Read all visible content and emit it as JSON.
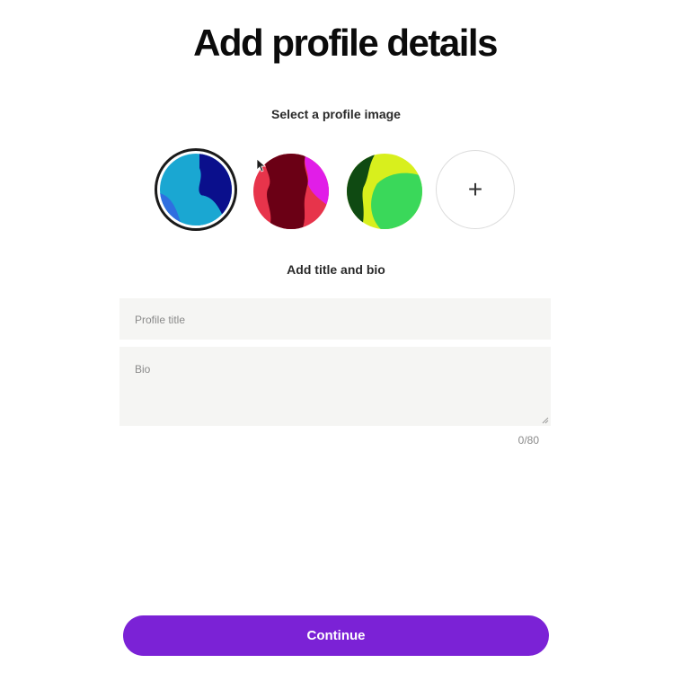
{
  "header": {
    "title": "Add profile details"
  },
  "profile_image": {
    "label": "Select a profile image",
    "options": [
      {
        "icon": "abstract-blue-avatar-icon",
        "selected": true,
        "colors": [
          "#1a9fce",
          "#0a0f8c",
          "#2e7be0"
        ]
      },
      {
        "icon": "abstract-red-avatar-icon",
        "selected": false,
        "colors": [
          "#e8324a",
          "#6a0014",
          "#e11de8"
        ]
      },
      {
        "icon": "abstract-green-avatar-icon",
        "selected": false,
        "colors": [
          "#d6f01c",
          "#0f4a12",
          "#38d95a"
        ]
      }
    ],
    "add_label": "+"
  },
  "bio_section": {
    "label": "Add title and bio",
    "title_placeholder": "Profile title",
    "bio_placeholder": "Bio",
    "counter": "0/80"
  },
  "actions": {
    "continue_label": "Continue"
  },
  "colors": {
    "accent": "#7b22d6",
    "field_background": "#f5f5f3"
  }
}
